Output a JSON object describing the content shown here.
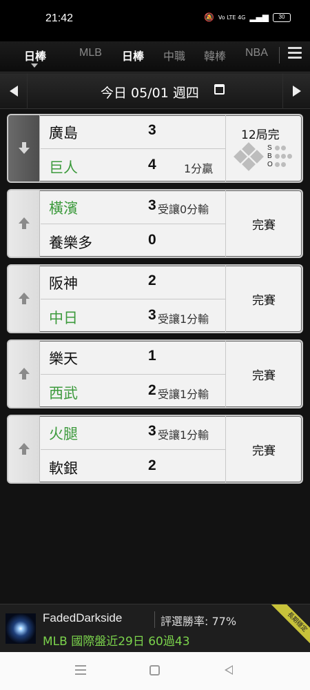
{
  "status_bar": {
    "time": "21:42",
    "signal_text": "Vo LTE 4G",
    "battery": "30"
  },
  "nav": {
    "current_section": "日棒",
    "tabs": [
      {
        "label": "MLB",
        "active": false
      },
      {
        "label": "日棒",
        "active": true
      },
      {
        "label": "中職",
        "active": false
      },
      {
        "label": "韓棒",
        "active": false
      },
      {
        "label": "NBA",
        "active": false
      }
    ]
  },
  "date_bar": {
    "label": "今日 05/01 週四"
  },
  "games": [
    {
      "live": true,
      "arrow": "down",
      "team1": {
        "name": "廣島",
        "score": "3",
        "note": "",
        "winner": false
      },
      "team2": {
        "name": "巨人",
        "score": "4",
        "note": "1分贏",
        "winner": true
      },
      "status": "12局完",
      "sbo": [
        "S",
        "B",
        "O"
      ]
    },
    {
      "live": false,
      "arrow": "up",
      "team1": {
        "name": "橫濱",
        "score": "3",
        "note": "受讓0分輸",
        "winner": true
      },
      "team2": {
        "name": "養樂多",
        "score": "0",
        "note": "",
        "winner": false
      },
      "status": "完賽"
    },
    {
      "live": false,
      "arrow": "up",
      "team1": {
        "name": "阪神",
        "score": "2",
        "note": "",
        "winner": false
      },
      "team2": {
        "name": "中日",
        "score": "3",
        "note": "受讓1分輸",
        "winner": true
      },
      "status": "完賽"
    },
    {
      "live": false,
      "arrow": "up",
      "team1": {
        "name": "樂天",
        "score": "1",
        "note": "",
        "winner": false
      },
      "team2": {
        "name": "西武",
        "score": "2",
        "note": "受讓1分輸",
        "winner": true
      },
      "status": "完賽"
    },
    {
      "live": false,
      "arrow": "up",
      "team1": {
        "name": "火腿",
        "score": "3",
        "note": "受讓1分輸",
        "winner": true
      },
      "team2": {
        "name": "軟銀",
        "score": "2",
        "note": "",
        "winner": false
      },
      "status": "完賽"
    }
  ],
  "footer": {
    "username": "FadedDarkside",
    "win_rate": "評選勝率: 77%",
    "record": "MLB 國際盤近29日 60過43",
    "badge": "長期穩定"
  },
  "colors": {
    "win_green": "#3c9a3c",
    "record_green": "#7bd34c"
  }
}
